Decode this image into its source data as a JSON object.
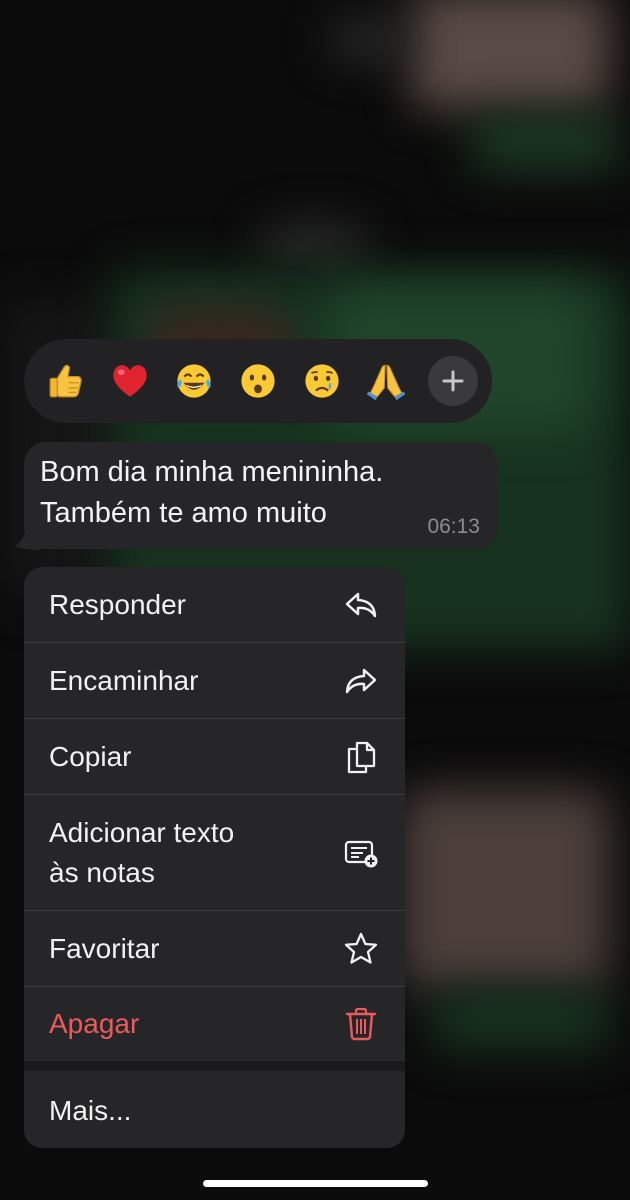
{
  "reactions": {
    "items": [
      {
        "name": "thumbs-up",
        "glyph": "👍"
      },
      {
        "name": "red-heart",
        "glyph": "❤️"
      },
      {
        "name": "tears-of-joy",
        "glyph": "😂"
      },
      {
        "name": "surprised",
        "glyph": "😮"
      },
      {
        "name": "crying",
        "glyph": "😢"
      },
      {
        "name": "folded-hands",
        "glyph": "🙏"
      }
    ],
    "more_icon": "plus-icon"
  },
  "message": {
    "line1": "Bom dia minha menininha.",
    "line2": "Também te amo muito",
    "time": "06:13"
  },
  "menu": {
    "reply": {
      "label": "Responder",
      "icon": "reply-icon"
    },
    "forward": {
      "label": "Encaminhar",
      "icon": "forward-icon"
    },
    "copy": {
      "label": "Copiar",
      "icon": "copy-icon"
    },
    "add_to_notes": {
      "label_line1": "Adicionar texto",
      "label_line2": "às notas",
      "icon": "add-note-icon"
    },
    "favorite": {
      "label": "Favoritar",
      "icon": "star-icon"
    },
    "delete": {
      "label": "Apagar",
      "icon": "trash-icon"
    },
    "more": {
      "label": "Mais..."
    }
  },
  "colors": {
    "menu_bg": "#262628",
    "danger": "#ea5b5d",
    "time_text": "#8d8d92"
  }
}
